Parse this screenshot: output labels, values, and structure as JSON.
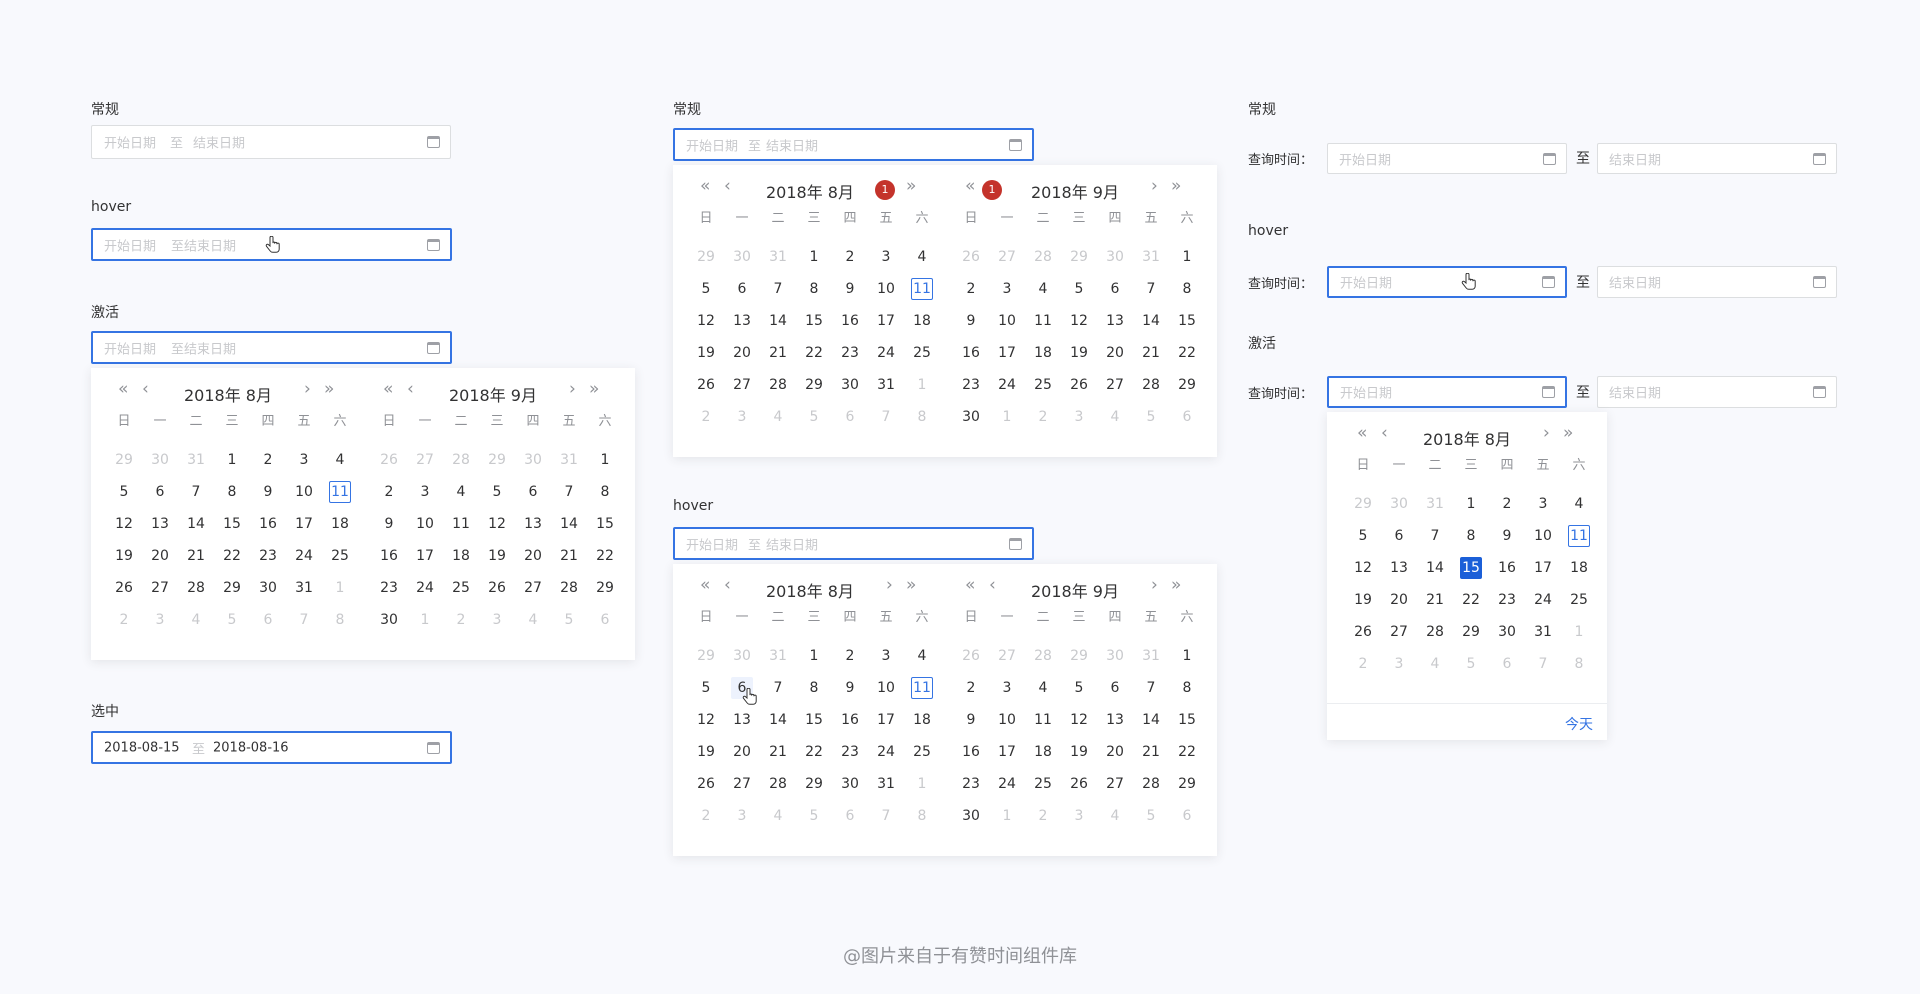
{
  "placeholders": {
    "start": "开始日期",
    "sep": "至",
    "end": "结束日期"
  },
  "section_labels": {
    "normal": "常规",
    "hover": "hover",
    "active": "激活",
    "selected": "选中"
  },
  "query_label": "查询时间：",
  "selected_range": {
    "start": "2018-08-15",
    "end": "2018-08-16"
  },
  "weekdays": [
    "日",
    "一",
    "二",
    "三",
    "四",
    "五",
    "六"
  ],
  "nav": {
    "prev_year": "«",
    "prev_month": "‹",
    "next_month": "›",
    "next_year": "»"
  },
  "months": [
    {
      "title": "2018年 8月",
      "days": [
        "29",
        "30",
        "31",
        "1",
        "2",
        "3",
        "4",
        "5",
        "6",
        "7",
        "8",
        "9",
        "10",
        "11",
        "12",
        "13",
        "14",
        "15",
        "16",
        "17",
        "18",
        "19",
        "20",
        "21",
        "22",
        "23",
        "24",
        "25",
        "26",
        "27",
        "28",
        "29",
        "30",
        "31",
        "1",
        "2",
        "3",
        "4",
        "5",
        "6",
        "7",
        "8"
      ],
      "muted_head": 3,
      "muted_tail_from": 34,
      "today_index": 13
    },
    {
      "title": "2018年 9月",
      "days": [
        "26",
        "27",
        "28",
        "29",
        "30",
        "31",
        "1",
        "2",
        "3",
        "4",
        "5",
        "6",
        "7",
        "8",
        "9",
        "10",
        "11",
        "12",
        "13",
        "14",
        "15",
        "16",
        "17",
        "18",
        "19",
        "20",
        "21",
        "22",
        "23",
        "24",
        "25",
        "26",
        "27",
        "28",
        "29",
        "30",
        "1",
        "2",
        "3",
        "4",
        "5",
        "6"
      ],
      "muted_head": 6,
      "muted_tail_from": 36,
      "today_index": -1
    }
  ],
  "badge_value": "1",
  "today_button": "今天",
  "selected_day_index": 17,
  "hover_day_index": 8,
  "watermark": "@图片来自于有赞时间组件库",
  "colors": {
    "accent": "#3574e3",
    "selected": "#1b5fd8",
    "badge": "#c4332b",
    "muted": "#c8c9cc",
    "background": "#f8f9fd"
  }
}
